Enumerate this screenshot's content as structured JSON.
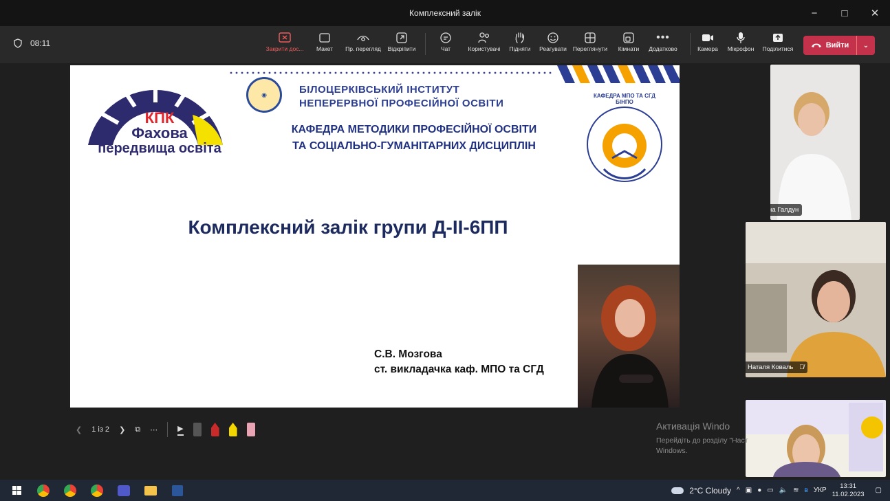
{
  "window": {
    "title": "Комплексний залік",
    "minimize": "−",
    "maximize": "□",
    "close": "✕"
  },
  "meeting": {
    "elapsed": "08:11",
    "toolbar": [
      {
        "label": "Закрити дос...",
        "icon": "stop-sharing-icon"
      },
      {
        "label": "Макет",
        "icon": "layout-icon"
      },
      {
        "label": "Пр. перегляд",
        "icon": "preview-eye-icon"
      },
      {
        "label": "Відкріпити",
        "icon": "popout-icon"
      },
      {
        "label": "Чат",
        "icon": "chat-icon"
      },
      {
        "label": "Користувачі",
        "icon": "people-icon"
      },
      {
        "label": "Підняти",
        "icon": "raise-hand-icon"
      },
      {
        "label": "Реагувати",
        "icon": "reaction-icon"
      },
      {
        "label": "Переглянути",
        "icon": "view-grid-icon"
      },
      {
        "label": "Кімнати",
        "icon": "rooms-icon"
      },
      {
        "label": "Додатково",
        "icon": "more-icon"
      },
      {
        "label": "Камера",
        "icon": "camera-icon"
      },
      {
        "label": "Мікрофон",
        "icon": "mic-icon"
      },
      {
        "label": "Поділитися",
        "icon": "share-icon"
      }
    ],
    "leave_label": "Вийти",
    "colors": {
      "leave": "#c4314b",
      "accent_red": "#f25b5b"
    }
  },
  "slide": {
    "kpk_logo": {
      "line1": "КПК",
      "line2": "Фахова",
      "line3": "передвища освіта"
    },
    "institute": {
      "line1": "БІЛОЦЕРКІВСЬКИЙ ІНСТИТУТ",
      "line2": "НЕПЕРЕРВНОЇ ПРОФЕСІЙНОЇ ОСВІТИ"
    },
    "department": {
      "line1": "КАФЕДРА МЕТОДИКИ ПРОФЕСІЙНОЇ ОСВІТИ",
      "line2": "ТА СОЦІАЛЬНО-ГУМАНІТАРНИХ ДИСЦИПЛІН"
    },
    "dept_seal_text": "КАФЕДРА МПО ТА СГД БІНПО",
    "title": "Комплексний залік групи Д-ІІ-6ПП",
    "lecturer_name": "С.В. Мозгова",
    "lecturer_role": "ст. викладачка каф. МПО та СГД"
  },
  "slide_controls": {
    "page": "1 із 2"
  },
  "participants": [
    {
      "name": "Олена Галдун"
    },
    {
      "name": "Наталя Коваль",
      "muted": true
    }
  ],
  "activation": {
    "line1": "Активація Windo",
    "line2": "Перейдіть до розділу \"Наст",
    "line3": "Windows."
  },
  "taskbar": {
    "weather": "2°C Cloudy",
    "language": "УКР",
    "time": "13:31",
    "date": "11.02.2023"
  }
}
